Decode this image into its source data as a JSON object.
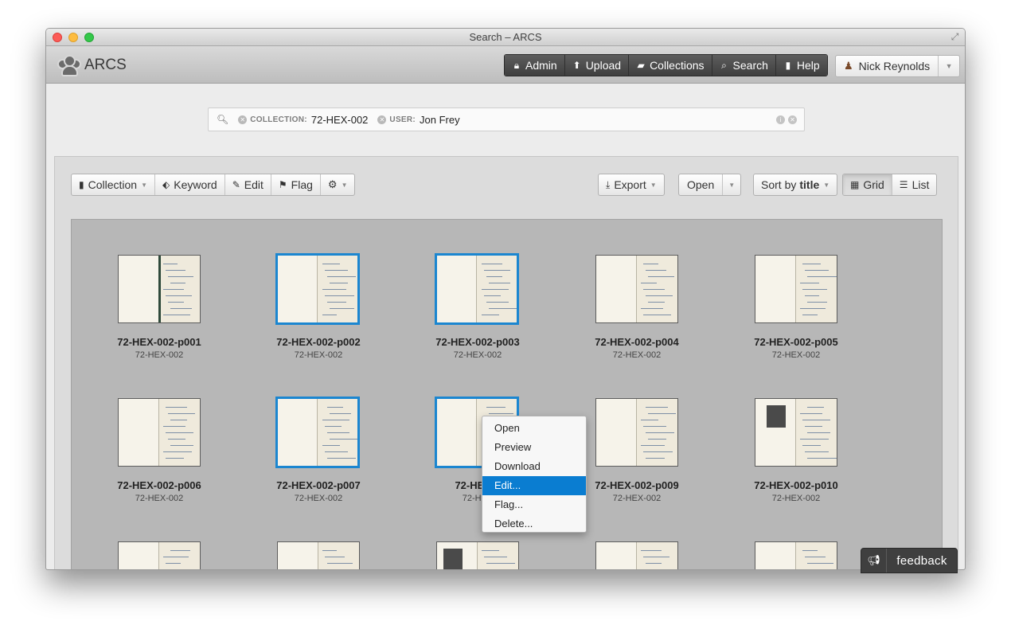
{
  "window": {
    "title": "Search – ARCS"
  },
  "app": {
    "logo_text": "ARCS"
  },
  "nav": {
    "items": [
      {
        "label": "Admin",
        "icon": "lock-icon"
      },
      {
        "label": "Upload",
        "icon": "upload-icon"
      },
      {
        "label": "Collections",
        "icon": "folder-icon"
      },
      {
        "label": "Search",
        "icon": "search-icon"
      },
      {
        "label": "Help",
        "icon": "book-icon"
      }
    ],
    "user": {
      "name": "Nick Reynolds",
      "icon": "user-icon"
    }
  },
  "search": {
    "chips": [
      {
        "key": "COLLECTION:",
        "value": "72-HEX-002"
      },
      {
        "key": "USER:",
        "value": "Jon Frey"
      }
    ]
  },
  "toolbar": {
    "left": [
      {
        "label": "Collection",
        "icon": "book-icon",
        "dropdown": true
      },
      {
        "label": "Keyword",
        "icon": "tag-icon",
        "dropdown": false
      },
      {
        "label": "Edit",
        "icon": "pencil-icon",
        "dropdown": false
      },
      {
        "label": "Flag",
        "icon": "flag-icon",
        "dropdown": false
      },
      {
        "label": "",
        "icon": "gear-icon",
        "dropdown": true
      }
    ],
    "export_label": "Export",
    "open_label": "Open",
    "sort_prefix": "Sort by",
    "sort_field": "title",
    "view_grid_label": "Grid",
    "view_list_label": "List",
    "active_view": "Grid"
  },
  "results": [
    {
      "title": "72-HEX-002-p001",
      "collection": "72-HEX-002",
      "selected": false
    },
    {
      "title": "72-HEX-002-p002",
      "collection": "72-HEX-002",
      "selected": true
    },
    {
      "title": "72-HEX-002-p003",
      "collection": "72-HEX-002",
      "selected": true
    },
    {
      "title": "72-HEX-002-p004",
      "collection": "72-HEX-002",
      "selected": false
    },
    {
      "title": "72-HEX-002-p005",
      "collection": "72-HEX-002",
      "selected": false
    },
    {
      "title": "72-HEX-002-p006",
      "collection": "72-HEX-002",
      "selected": false
    },
    {
      "title": "72-HEX-002-p007",
      "collection": "72-HEX-002",
      "selected": true
    },
    {
      "title": "72-HEX-0",
      "collection": "72-HEX",
      "selected": true
    },
    {
      "title": "72-HEX-002-p009",
      "collection": "72-HEX-002",
      "selected": false
    },
    {
      "title": "72-HEX-002-p010",
      "collection": "72-HEX-002",
      "selected": false
    },
    {
      "title": "",
      "collection": "",
      "selected": false
    },
    {
      "title": "",
      "collection": "",
      "selected": false
    },
    {
      "title": "",
      "collection": "",
      "selected": false
    },
    {
      "title": "",
      "collection": "",
      "selected": false
    },
    {
      "title": "",
      "collection": "",
      "selected": false
    }
  ],
  "context_menu": {
    "items": [
      "Open",
      "Preview",
      "Download",
      "Edit...",
      "Flag...",
      "Delete..."
    ],
    "highlighted": "Edit..."
  },
  "feedback": {
    "label": "feedback",
    "icon": "megaphone-icon"
  },
  "colors": {
    "selection": "#1b86d0",
    "highlight": "#0a7dd1",
    "nav_dark": "#4a4a4a"
  }
}
